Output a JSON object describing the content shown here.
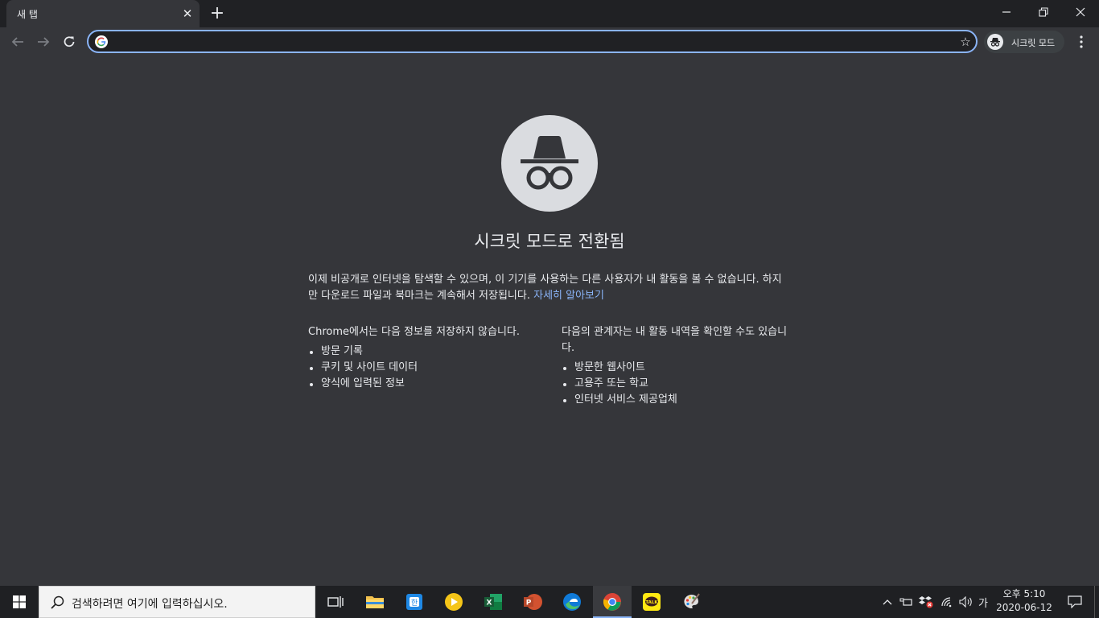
{
  "browser": {
    "tab": {
      "title": "새 탭"
    },
    "omnibox": {
      "value": "",
      "placeholder": ""
    },
    "incognito_chip": {
      "label": "시크릿 모드"
    }
  },
  "page": {
    "headline": "시크릿 모드로 전환됨",
    "intro": "이제 비공개로 인터넷을 탐색할 수 있으며, 이 기기를 사용하는 다른 사용자가 내 활동을 볼 수 없습니다. 하지만 다운로드 파일과 북마크는 계속해서 저장됩니다.",
    "learn_more": "자세히 알아보기",
    "not_saved": {
      "heading": "Chrome에서는 다음 정보를 저장하지 않습니다.",
      "items": [
        "방문 기록",
        "쿠키 및 사이트 데이터",
        "양식에 입력된 정보"
      ]
    },
    "may_see": {
      "heading": "다음의 관계자는 내 활동 내역을 확인할 수도 있습니다.",
      "items": [
        "방문한 웹사이트",
        "고용주 또는 학교",
        "인터넷 서비스 제공업체"
      ]
    }
  },
  "taskbar": {
    "search_placeholder": "검색하려면 여기에 입력하십시오.",
    "ime": "가",
    "time": "오후 5:10",
    "date": "2020-06-12"
  },
  "colors": {
    "page_bg": "#35363a",
    "tabstrip_bg": "#202124",
    "accent_blue": "#8ab4f8",
    "text": "#e8eaed"
  }
}
